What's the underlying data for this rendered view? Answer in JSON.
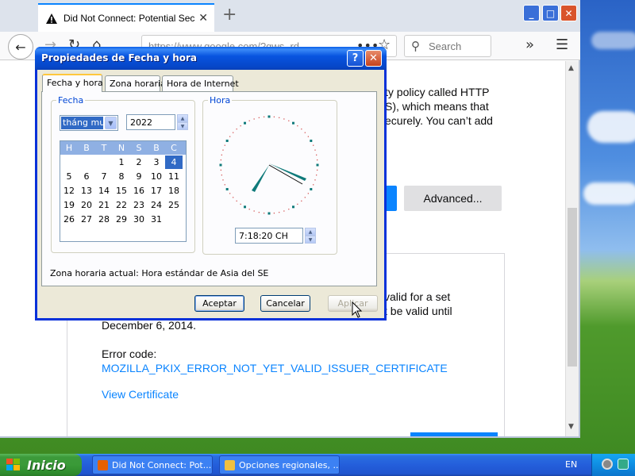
{
  "browser": {
    "tab_title": "Did Not Connect: Potential Securi",
    "new_tab": "+",
    "url": "https://www.google.com/?gws_rd...",
    "search_placeholder": "Search",
    "window_controls": [
      "_",
      "□",
      "✕"
    ],
    "content": {
      "line1": "ty policy called HTTP",
      "line2": "S), which means that",
      "line3": "ecurely. You can’t add",
      "advanced_button": "Advanced...",
      "cert_line1": "valid for a set",
      "cert_line2": "t be valid until",
      "cert_date": "December 6, 2014.",
      "error_code_label": "Error code:",
      "error_code": "MOZILLA_PKIX_ERROR_NOT_YET_VALID_ISSUER_CERTIFICATE",
      "view_certificate": "View Certificate"
    }
  },
  "dialog": {
    "title": "Propiedades de Fecha y hora",
    "help": "?",
    "close": "✕",
    "tabs": [
      "Fecha y hora",
      "Zona horaria",
      "Hora de Internet"
    ],
    "date_group": "Fecha",
    "month_value": "tháng mười",
    "year_value": "2022",
    "weekdays": [
      "H",
      "B",
      "T",
      "N",
      "S",
      "B",
      "C"
    ],
    "calendar_weeks": [
      [
        "",
        "",
        "",
        "",
        "1",
        "2",
        "3",
        "4"
      ],
      [
        "5",
        "6",
        "7",
        "8",
        "9",
        "10",
        "11"
      ],
      [
        "12",
        "13",
        "14",
        "15",
        "16",
        "17",
        "18"
      ],
      [
        "19",
        "20",
        "21",
        "22",
        "23",
        "24",
        "25"
      ],
      [
        "26",
        "27",
        "28",
        "29",
        "30",
        "31"
      ]
    ],
    "selected_day": "4",
    "time_group": "Hora",
    "time_value": "7:18:20 CH",
    "timezone_label": "Zona horaria actual:  Hora estándar de Asia del SE",
    "ok": "Aceptar",
    "cancel": "Cancelar",
    "apply": "Aplicar"
  },
  "taskbar": {
    "start": "Inicio",
    "tasks": [
      "Did Not Connect: Pot...",
      "Opciones regionales, ..."
    ],
    "language": "EN"
  },
  "colors": {
    "xp_blue": "#0831d9",
    "firefox_accent": "#0a84ff",
    "dialog_bg": "#ece9d8",
    "selection": "#316ac5",
    "clock_hands": "#0f7a7a"
  }
}
